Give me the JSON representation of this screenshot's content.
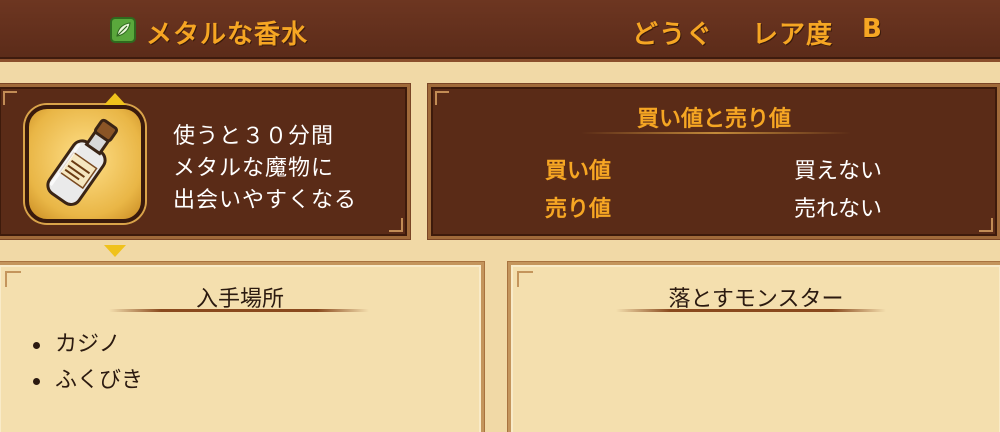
{
  "header": {
    "item_name": "メタルな香水",
    "category": "どうぐ",
    "rarity_label": "レア度",
    "rarity_value": "B",
    "category_icon": "leaf-icon"
  },
  "item": {
    "icon": "perfume-bottle-icon",
    "description": [
      "使うと３０分間",
      "メタルな魔物に",
      "出会いやすくなる"
    ]
  },
  "prices": {
    "title": "買い値と売り値",
    "buy_label": "買い値",
    "buy_value": "買えない",
    "sell_label": "売り値",
    "sell_value": "売れない"
  },
  "obtain": {
    "title": "入手場所",
    "items": [
      "カジノ",
      "ふくびき"
    ]
  },
  "drops": {
    "title": "落とすモンスター",
    "items": []
  }
}
